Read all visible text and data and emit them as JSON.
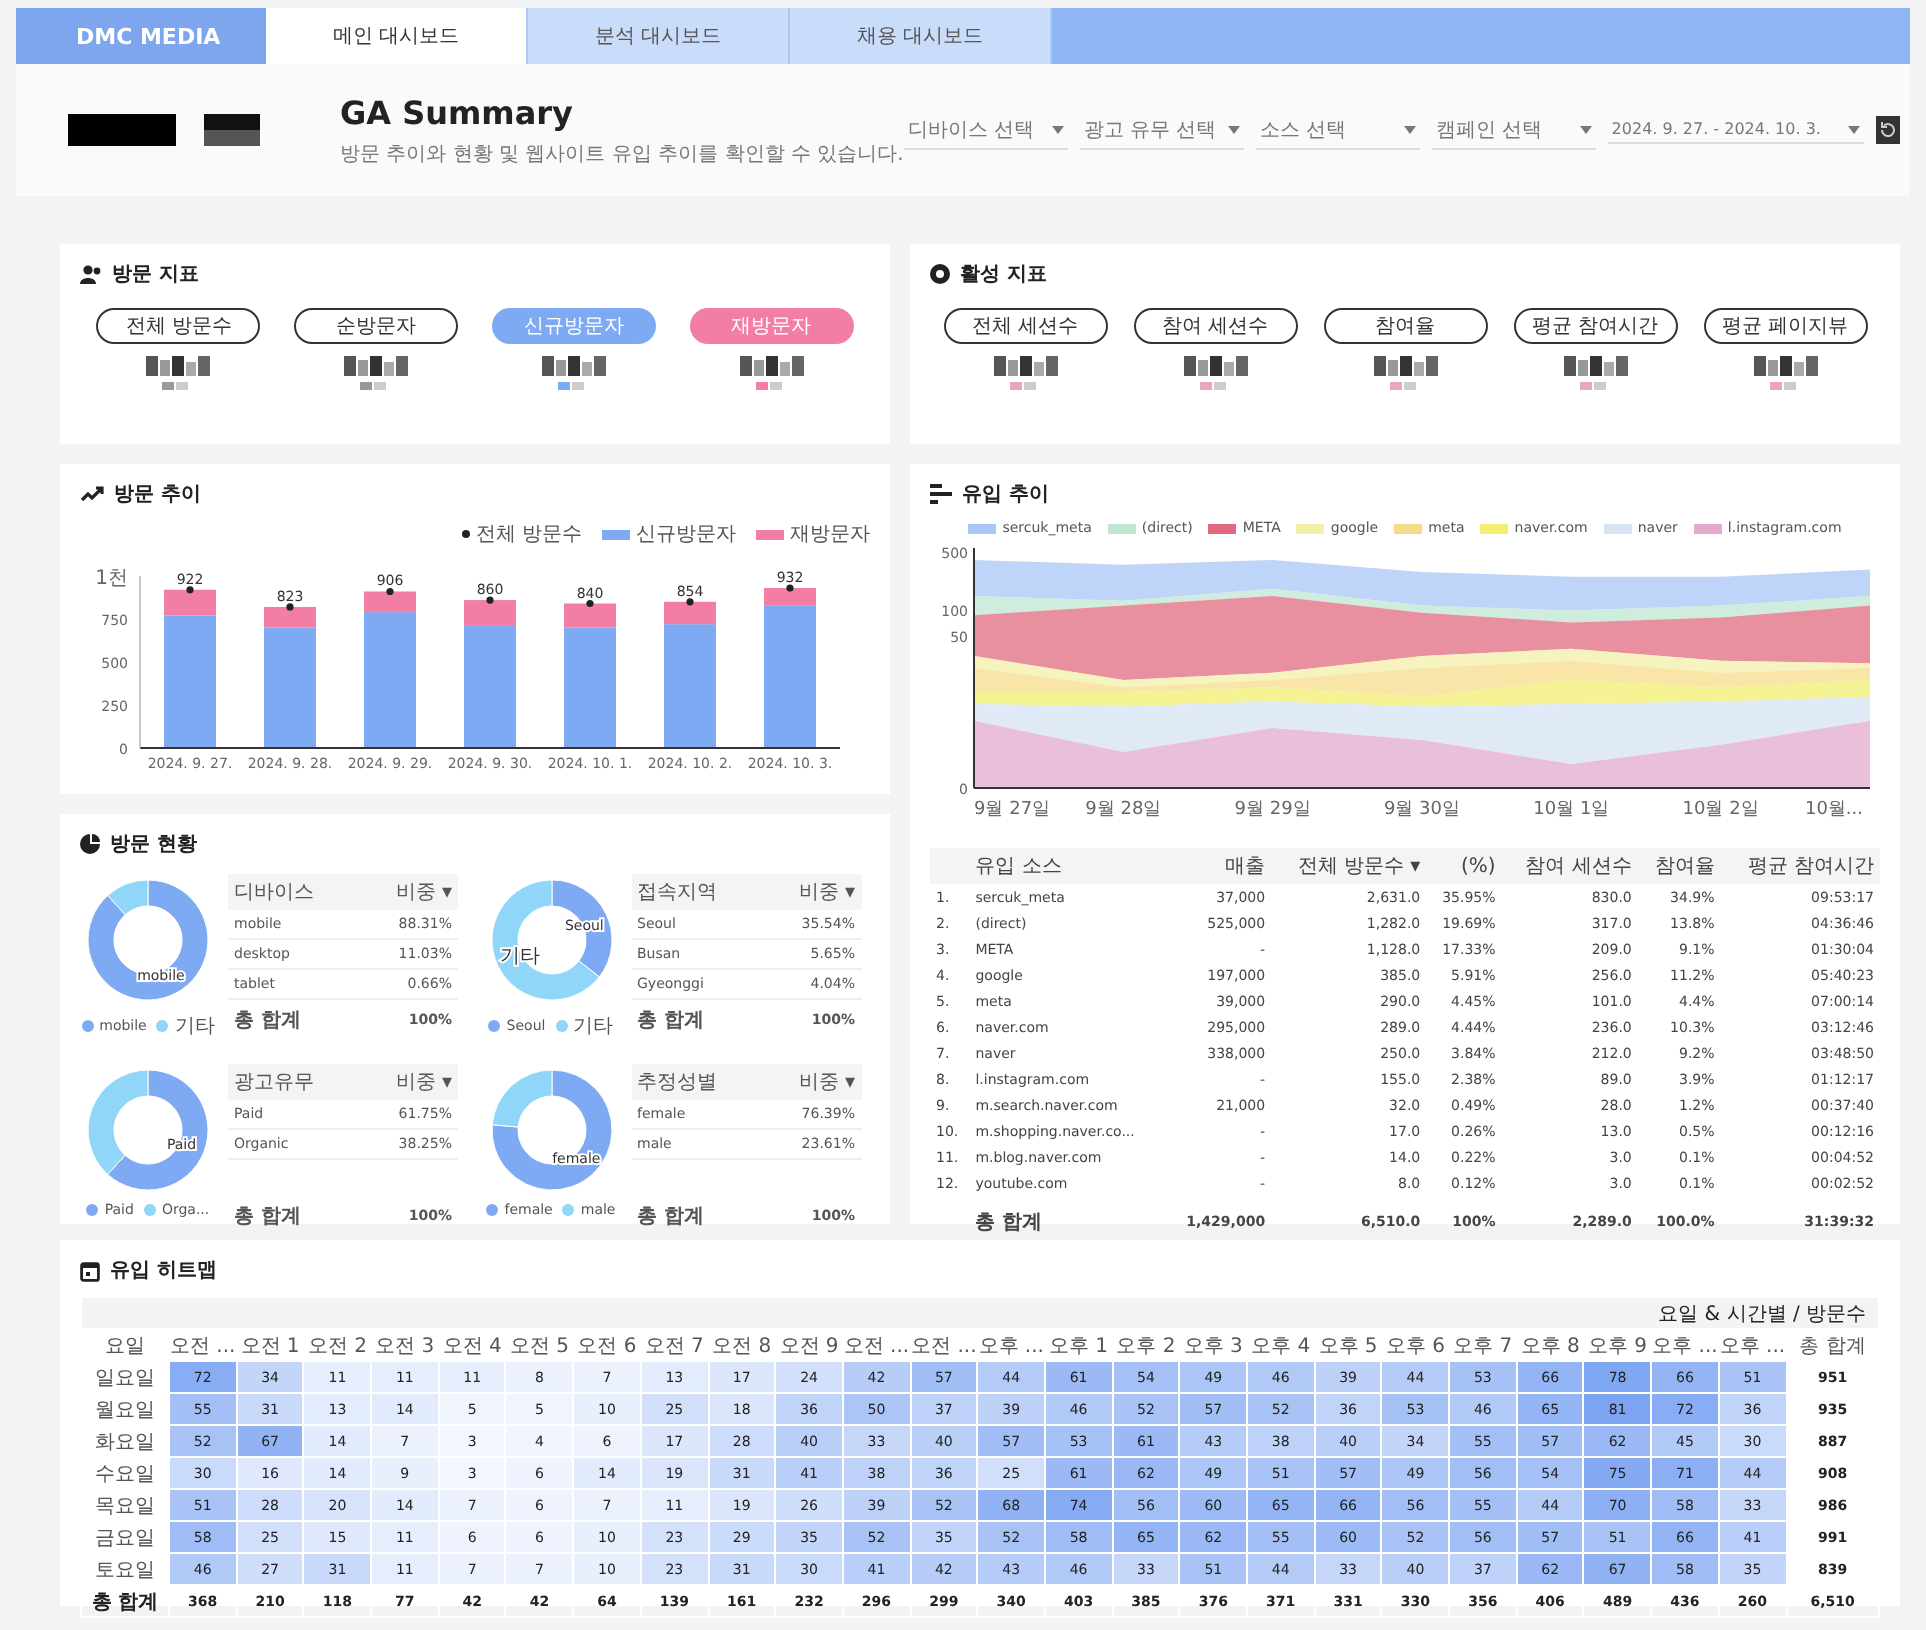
{
  "header": {
    "logo": "DMC MEDIA",
    "tabs": [
      {
        "label": "메인 대시보드",
        "selected": true
      },
      {
        "label": "분석 대시보드",
        "selected": false
      },
      {
        "label": "채용 대시보드",
        "selected": false
      }
    ]
  },
  "title": "GA Summary",
  "subtitle": "방문 추이와 현황 및 웹사이트 유입 추이를 확인할 수 있습니다.",
  "filters": [
    "디바이스 선택",
    "광고 유무 선택",
    "소스 선택",
    "캠페인 선택",
    "2024. 9. 27. - 2024. 10. 3."
  ],
  "visit_metrics": {
    "title": "방문 지표",
    "items": [
      {
        "label": "전체 방문수",
        "color": "#ffffff"
      },
      {
        "label": "순방문자",
        "color": "#ffffff"
      },
      {
        "label": "신규방문자",
        "color": "#7eaaf4"
      },
      {
        "label": "재방문자",
        "color": "#f37ea4"
      }
    ]
  },
  "active_metrics": {
    "title": "활성 지표",
    "items": [
      "전체 세션수",
      "참여 세션수",
      "참여율",
      "평균 참여시간",
      "평균 페이지뷰"
    ]
  },
  "visit_trend": {
    "title": "방문 추이",
    "total_series_name": "전체 방문수",
    "top_tick_label": "1천",
    "chart_data": {
      "type": "bar",
      "stacked": true,
      "legend": "top",
      "categories": [
        "2024. 9. 27.",
        "2024. 9. 28.",
        "2024. 9. 29.",
        "2024. 9. 30.",
        "2024. 10. 1.",
        "2024. 10. 2.",
        "2024. 10. 3."
      ],
      "ylim": [
        0,
        1000
      ],
      "yticks": [
        0,
        250,
        500,
        750
      ],
      "series": [
        {
          "name": "신규방문자",
          "color": "#7eaaf4",
          "values": [
            770,
            700,
            790,
            710,
            700,
            720,
            830
          ]
        },
        {
          "name": "재방문자",
          "color": "#f37ea4",
          "values": [
            150,
            120,
            120,
            150,
            140,
            130,
            100
          ]
        }
      ],
      "value_labels": [
        "922",
        "823",
        "906",
        "860",
        "840",
        "854",
        "932"
      ]
    }
  },
  "inflow_trend": {
    "title": "유입 추이",
    "chart": {
      "legend": [
        {
          "name": "sercuk_meta",
          "color": "#a8c6f6"
        },
        {
          "name": "(direct)",
          "color": "#bfe6d0"
        },
        {
          "name": "META",
          "color": "#e06a80"
        },
        {
          "name": "google",
          "color": "#f3efa8"
        },
        {
          "name": "meta",
          "color": "#f5dc8a"
        },
        {
          "name": "naver.com",
          "color": "#f2ee70"
        },
        {
          "name": "naver",
          "color": "#d6e3f3"
        },
        {
          "name": "l.instagram.com",
          "color": "#e3aacd"
        }
      ],
      "yticks": [
        "500",
        "100",
        "50",
        "0"
      ],
      "xlabels": [
        "9월 27일",
        "9월 28일",
        "9월 29일",
        "9월 30일",
        "10월 1일",
        "10월 2일",
        "10월..."
      ]
    },
    "table": {
      "columns": [
        "",
        "유입 소스",
        "매출",
        "전체 방문수 ▾",
        "(%)",
        "참여 세션수",
        "참여율",
        "평균 참여시간"
      ],
      "rows": [
        [
          "1.",
          "sercuk_meta",
          "37,000",
          "2,631.0",
          "35.95%",
          "830.0",
          "34.9%",
          "09:53:17"
        ],
        [
          "2.",
          "(direct)",
          "525,000",
          "1,282.0",
          "19.69%",
          "317.0",
          "13.8%",
          "04:36:46"
        ],
        [
          "3.",
          "META",
          "-",
          "1,128.0",
          "17.33%",
          "209.0",
          "9.1%",
          "01:30:04"
        ],
        [
          "4.",
          "google",
          "197,000",
          "385.0",
          "5.91%",
          "256.0",
          "11.2%",
          "05:40:23"
        ],
        [
          "5.",
          "meta",
          "39,000",
          "290.0",
          "4.45%",
          "101.0",
          "4.4%",
          "07:00:14"
        ],
        [
          "6.",
          "naver.com",
          "295,000",
          "289.0",
          "4.44%",
          "236.0",
          "10.3%",
          "03:12:46"
        ],
        [
          "7.",
          "naver",
          "338,000",
          "250.0",
          "3.84%",
          "212.0",
          "9.2%",
          "03:48:50"
        ],
        [
          "8.",
          "l.instagram.com",
          "-",
          "155.0",
          "2.38%",
          "89.0",
          "3.9%",
          "01:12:17"
        ],
        [
          "9.",
          "m.search.naver.com",
          "21,000",
          "32.0",
          "0.49%",
          "28.0",
          "1.2%",
          "00:37:40"
        ],
        [
          "10.",
          "m.shopping.naver.co...",
          "-",
          "17.0",
          "0.26%",
          "13.0",
          "0.5%",
          "00:12:16"
        ],
        [
          "11.",
          "m.blog.naver.com",
          "-",
          "14.0",
          "0.22%",
          "3.0",
          "0.1%",
          "00:04:52"
        ],
        [
          "12.",
          "youtube.com",
          "-",
          "8.0",
          "0.12%",
          "3.0",
          "0.1%",
          "00:02:52"
        ]
      ],
      "total": {
        "label": "총 합계",
        "values": [
          "1,429,000",
          "6,510.0",
          "100%",
          "2,289.0",
          "100.0%",
          "31:39:32"
        ]
      }
    }
  },
  "visit_status": {
    "title": "방문 현황",
    "panels": [
      {
        "chart_data": {
          "type": "donut",
          "categories": [
            "mobile",
            "기타"
          ],
          "values": [
            88.31,
            11.69
          ]
        },
        "slice_labels": [
          "mobile"
        ],
        "columns": [
          "디바이스",
          "비중 ▾"
        ],
        "rows": [
          [
            "mobile",
            "88.31%"
          ],
          [
            "desktop",
            "11.03%"
          ],
          [
            "tablet",
            "0.66%"
          ]
        ],
        "total": [
          "총 합계",
          "100%"
        ]
      },
      {
        "chart_data": {
          "type": "donut",
          "categories": [
            "Seoul",
            "기타"
          ],
          "values": [
            35.54,
            64.46
          ]
        },
        "slice_labels": [
          "Seoul",
          "기타"
        ],
        "columns": [
          "접속지역",
          "비중 ▾"
        ],
        "rows": [
          [
            "Seoul",
            "35.54%"
          ],
          [
            "Busan",
            "5.65%"
          ],
          [
            "Gyeonggi",
            "4.04%"
          ]
        ],
        "total": [
          "총 합계",
          "100%"
        ]
      },
      {
        "chart_data": {
          "type": "donut",
          "categories": [
            "Paid",
            "Orga..."
          ],
          "values": [
            61.75,
            38.25
          ]
        },
        "slice_labels": [
          "Paid"
        ],
        "columns": [
          "광고유무",
          "비중 ▾"
        ],
        "rows": [
          [
            "Paid",
            "61.75%"
          ],
          [
            "Organic",
            "38.25%"
          ]
        ],
        "total": [
          "총 합계",
          "100%"
        ]
      },
      {
        "chart_data": {
          "type": "donut",
          "categories": [
            "female",
            "male"
          ],
          "values": [
            76.39,
            23.61
          ]
        },
        "slice_labels": [
          "female"
        ],
        "columns": [
          "추정성별",
          "비중 ▾"
        ],
        "rows": [
          [
            "female",
            "76.39%"
          ],
          [
            "male",
            "23.61%"
          ]
        ],
        "total": [
          "총 합계",
          "100%"
        ]
      }
    ]
  },
  "heatmap": {
    "title": "유입 히트맵",
    "caption": "요일 & 시간별 / 방문수",
    "columns": [
      "요일",
      "오전 ...",
      "오전 1",
      "오전 2",
      "오전 3",
      "오전 4",
      "오전 5",
      "오전 6",
      "오전 7",
      "오전 8",
      "오전 9",
      "오전 ...",
      "오전 ...",
      "오후 ...",
      "오후 1",
      "오후 2",
      "오후 3",
      "오후 4",
      "오후 5",
      "오후 6",
      "오후 7",
      "오후 8",
      "오후 9",
      "오후 ...",
      "오후 ...",
      "총 합계"
    ],
    "rows": [
      {
        "day": "일요일",
        "values": [
          "72",
          "34",
          "11",
          "11",
          "11",
          "8",
          "7",
          "13",
          "17",
          "24",
          "42",
          "57",
          "44",
          "61",
          "54",
          "49",
          "46",
          "39",
          "44",
          "53",
          "66",
          "78",
          "66",
          "51"
        ],
        "total": "951"
      },
      {
        "day": "월요일",
        "values": [
          "55",
          "31",
          "13",
          "14",
          "5",
          "5",
          "10",
          "25",
          "18",
          "36",
          "50",
          "37",
          "39",
          "46",
          "52",
          "57",
          "52",
          "36",
          "53",
          "46",
          "65",
          "81",
          "72",
          "36"
        ],
        "total": "935"
      },
      {
        "day": "화요일",
        "values": [
          "52",
          "67",
          "14",
          "7",
          "3",
          "4",
          "6",
          "17",
          "28",
          "40",
          "33",
          "40",
          "57",
          "53",
          "61",
          "43",
          "38",
          "40",
          "34",
          "55",
          "57",
          "62",
          "45",
          "30"
        ],
        "total": "887"
      },
      {
        "day": "수요일",
        "values": [
          "30",
          "16",
          "14",
          "9",
          "3",
          "6",
          "14",
          "19",
          "31",
          "41",
          "38",
          "36",
          "25",
          "61",
          "62",
          "49",
          "51",
          "57",
          "49",
          "56",
          "54",
          "75",
          "71",
          "44"
        ],
        "total": "908"
      },
      {
        "day": "목요일",
        "values": [
          "51",
          "28",
          "20",
          "14",
          "7",
          "6",
          "7",
          "11",
          "19",
          "26",
          "39",
          "52",
          "68",
          "74",
          "56",
          "60",
          "65",
          "66",
          "56",
          "55",
          "44",
          "70",
          "58",
          "33"
        ],
        "total": "986"
      },
      {
        "day": "금요일",
        "values": [
          "58",
          "25",
          "15",
          "11",
          "6",
          "6",
          "10",
          "23",
          "29",
          "35",
          "52",
          "35",
          "52",
          "58",
          "65",
          "62",
          "55",
          "60",
          "52",
          "56",
          "57",
          "51",
          "66",
          "41"
        ],
        "total": "991"
      },
      {
        "day": "토요일",
        "values": [
          "46",
          "27",
          "31",
          "11",
          "7",
          "7",
          "10",
          "23",
          "31",
          "30",
          "41",
          "42",
          "43",
          "46",
          "33",
          "51",
          "44",
          "33",
          "40",
          "37",
          "62",
          "67",
          "58",
          "35"
        ],
        "total": "839"
      }
    ],
    "total_row": {
      "day": "총 합계",
      "values": [
        "368",
        "210",
        "118",
        "77",
        "42",
        "42",
        "64",
        "139",
        "161",
        "232",
        "296",
        "299",
        "340",
        "403",
        "385",
        "376",
        "371",
        "331",
        "330",
        "356",
        "406",
        "489",
        "436",
        "260"
      ],
      "total": "6,510"
    }
  }
}
